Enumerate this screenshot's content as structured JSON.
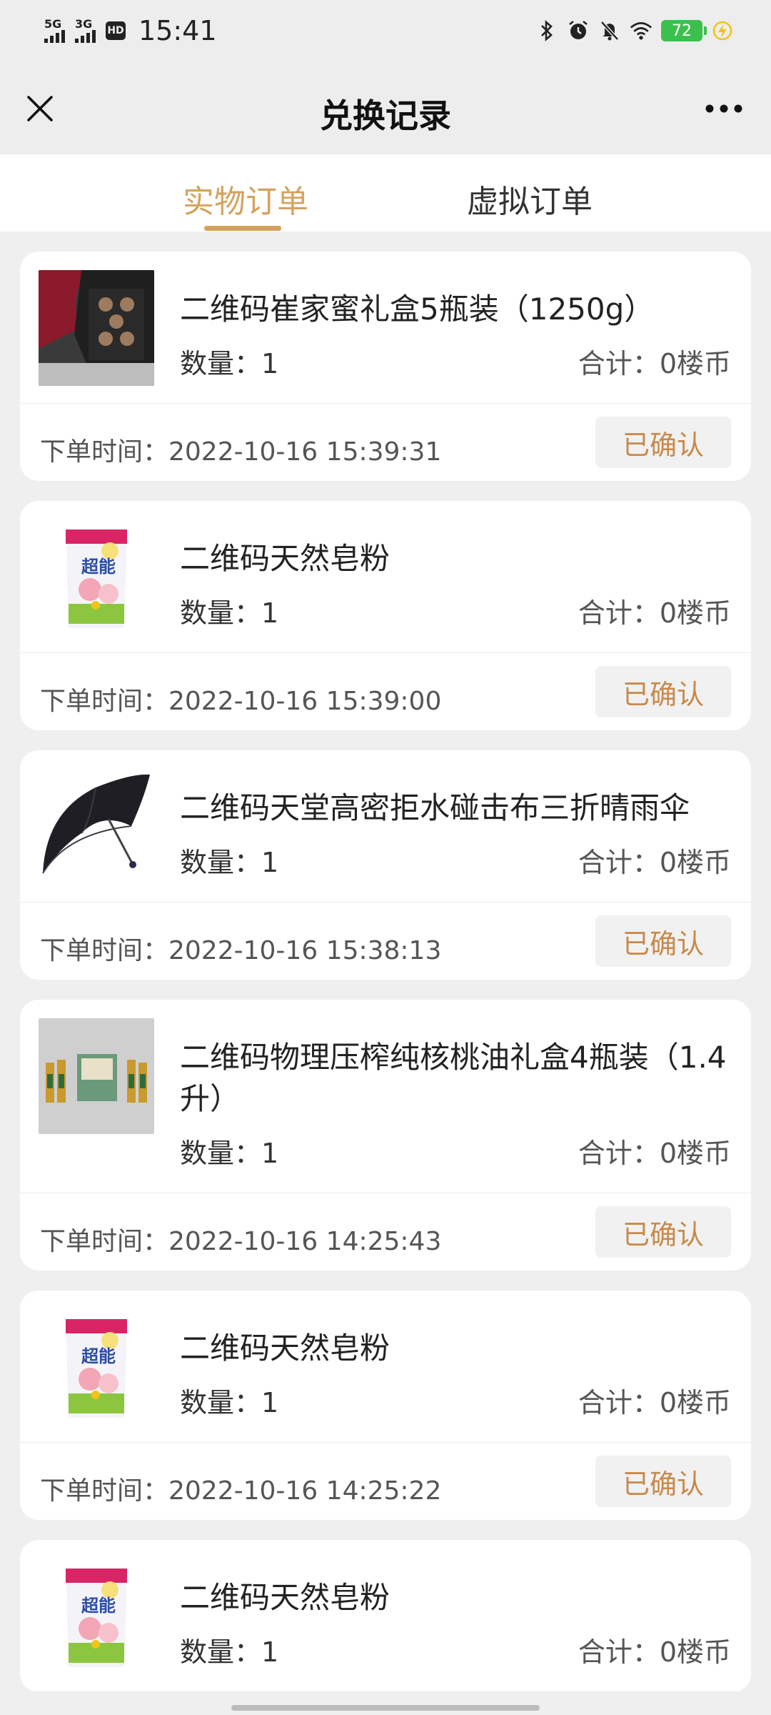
{
  "status_bar": {
    "signal1_label": "5G",
    "signal2_label": "3G",
    "hd_label": "HD",
    "time": "15:41",
    "battery": "72",
    "icons": [
      "bluetooth-icon",
      "alarm-icon",
      "mute-icon",
      "wifi-icon",
      "charging-icon"
    ]
  },
  "navbar": {
    "title": "兑换记录",
    "close_icon": "close-icon",
    "more_icon": "more-icon"
  },
  "tabs": [
    {
      "label": "实物订单",
      "active": true
    },
    {
      "label": "虚拟订单",
      "active": false
    }
  ],
  "labels": {
    "qty_prefix": "数量：",
    "total_prefix": "合计：",
    "time_prefix": "下单时间："
  },
  "orders": [
    {
      "name": "二维码崔家蜜礼盒5瓶装（1250g）",
      "qty": "数量：1",
      "total": "合计：0楼币",
      "time": "下单时间：2022-10-16 15:39:31",
      "status": "已确认",
      "thumb": "honey-gift-box-image"
    },
    {
      "name": "二维码天然皂粉",
      "qty": "数量：1",
      "total": "合计：0楼币",
      "time": "下单时间：2022-10-16 15:39:00",
      "status": "已确认",
      "thumb": "soap-powder-image"
    },
    {
      "name": "二维码天堂高密拒水碰击布三折晴雨伞",
      "qty": "数量：1",
      "total": "合计：0楼币",
      "time": "下单时间：2022-10-16 15:38:13",
      "status": "已确认",
      "thumb": "umbrella-image"
    },
    {
      "name": "二维码物理压榨纯核桃油礼盒4瓶装（1.4升）",
      "qty": "数量：1",
      "total": "合计：0楼币",
      "time": "下单时间：2022-10-16 14:25:43",
      "status": "已确认",
      "thumb": "walnut-oil-gift-box-image"
    },
    {
      "name": "二维码天然皂粉",
      "qty": "数量：1",
      "total": "合计：0楼币",
      "time": "下单时间：2022-10-16 14:25:22",
      "status": "已确认",
      "thumb": "soap-powder-image"
    },
    {
      "name": "二维码天然皂粉",
      "qty": "数量：1",
      "total": "合计：0楼币",
      "time": "",
      "status": "",
      "thumb": "soap-powder-image"
    }
  ],
  "colors": {
    "accent": "#d4a25f",
    "status_text": "#c9894a",
    "background": "#efefef",
    "battery": "#3cc04d"
  }
}
